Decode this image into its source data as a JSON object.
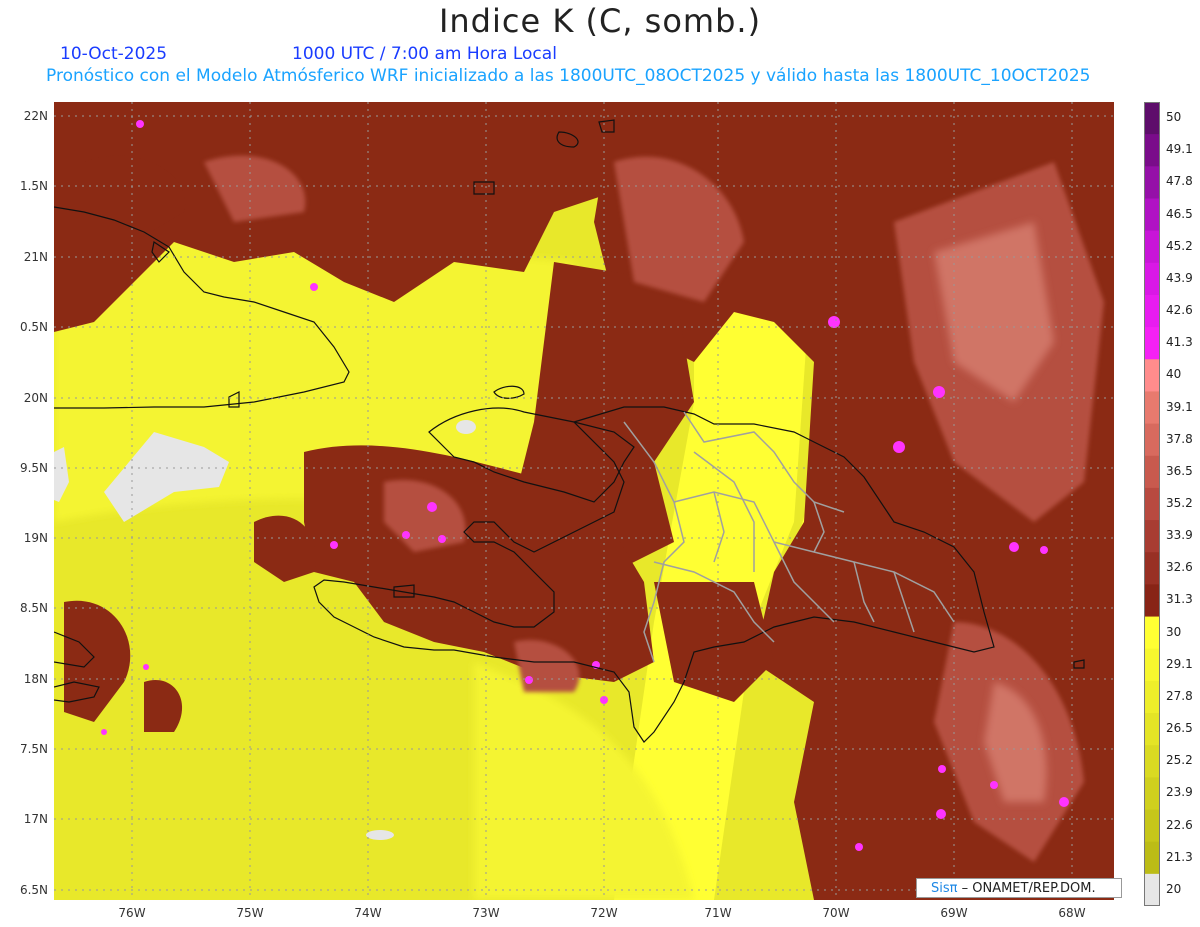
{
  "title": "Indice K (C, somb.)",
  "header": {
    "date": "10-Oct-2025",
    "time": "1000 UTC / 7:00 am Hora Local",
    "subtitle": "Pronóstico con el Modelo Atmósferico WRF inicializado a las 1800UTC_08OCT2025 y válido hasta las  1800UTC_10OCT2025"
  },
  "axes": {
    "lat_labels": [
      "22N",
      "1.5N",
      "21N",
      "0.5N",
      "20N",
      "9.5N",
      "19N",
      "8.5N",
      "18N",
      "7.5N",
      "17N",
      "6.5N"
    ],
    "lon_labels": [
      "76W",
      "75W",
      "74W",
      "73W",
      "72W",
      "71W",
      "70W",
      "69W",
      "68W"
    ]
  },
  "colorbar": {
    "labels": [
      "50",
      "49.1",
      "47.8",
      "46.5",
      "45.2",
      "43.9",
      "42.6",
      "41.3",
      "40",
      "39.1",
      "37.8",
      "36.5",
      "35.2",
      "33.9",
      "32.6",
      "31.3",
      "30",
      "29.1",
      "27.8",
      "26.5",
      "25.2",
      "23.9",
      "22.6",
      "21.3",
      "20"
    ],
    "colors": [
      "#5e0d6b",
      "#7a0c8a",
      "#9510a8",
      "#b012c4",
      "#c815d8",
      "#d918e6",
      "#e81cf0",
      "#f521f5",
      "#ff8c8c",
      "#e87a6e",
      "#d86a5e",
      "#c85a4e",
      "#b84a40",
      "#a83c32",
      "#983024",
      "#882416",
      "#ffff33",
      "#f7f72e",
      "#eeee2a",
      "#e4e426",
      "#dada22",
      "#d0d01e",
      "#c6c61a",
      "#bcbc16",
      "#e6e6e6"
    ]
  },
  "colors": {
    "low_yellow": "#e8e82a",
    "mid_yellow": "#ffff33",
    "dark_brown": "#8b2a14",
    "mid_brown": "#a94a3c",
    "salmon": "#c9665a",
    "magenta": "#ff33ff",
    "no_data": "#e6e6e6"
  },
  "credit": {
    "brand": "Sisπ",
    "text": " – ONAMET/REP.DOM."
  }
}
